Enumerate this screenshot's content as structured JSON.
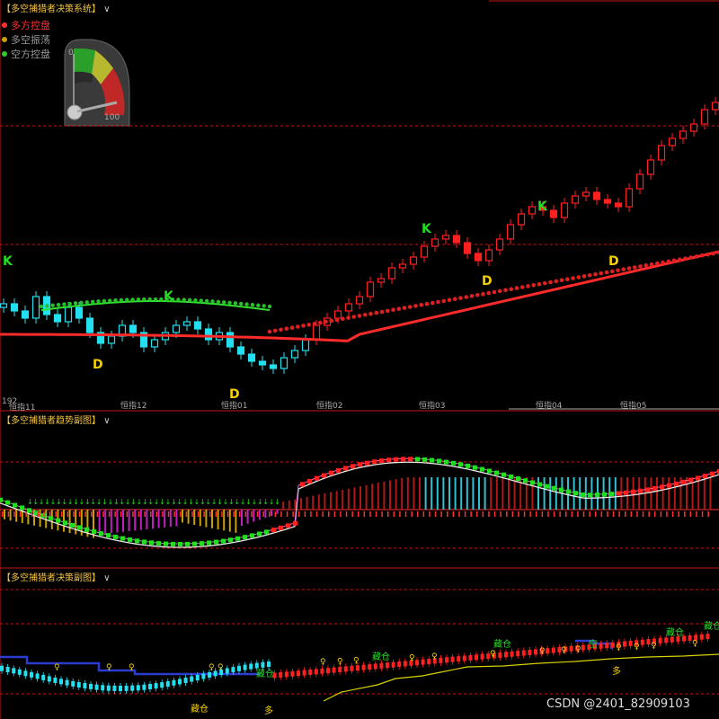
{
  "panels": {
    "main_title": "【多空捕猎者决策系统】",
    "trend_title": "【多空捕猎者趋势副图】",
    "decision_title": "【多空捕猎者决策副图】",
    "dropdown_glyph": "∨"
  },
  "legend": [
    {
      "label": "多方控盘",
      "color": "#ff3030"
    },
    {
      "label": "多空振荡",
      "color": "#c8a000"
    },
    {
      "label": "空方控盘",
      "color": "#2ecc2e"
    }
  ],
  "gauge": {
    "min_label": "0",
    "max_label": "100",
    "value": 0.85
  },
  "x_axis": {
    "first_label": "192",
    "ticks": [
      "恒指11",
      "恒指12",
      "恒指01",
      "恒指02",
      "恒指03",
      "恒指04",
      "恒指05"
    ]
  },
  "signals": {
    "k": "K",
    "d": "D"
  },
  "decision_labels": {
    "cang": "藏仓",
    "duo": "多",
    "kong": "空"
  },
  "watermark": "CSDN @2401_82909103",
  "colors": {
    "up": "#ff2020",
    "down": "#22e0f0",
    "grid": "#c01818",
    "signal_k": "#22dd22",
    "signal_d": "#f5d000"
  },
  "chart_data": {
    "type": "candlestick",
    "series": [
      {
        "values": [
          20,
          18,
          16,
          22,
          17,
          15,
          19,
          16,
          12,
          9,
          11,
          14,
          12,
          8,
          10,
          12,
          14,
          15,
          13,
          10,
          12,
          8,
          6,
          4,
          3,
          2,
          5,
          7,
          10,
          14,
          16,
          18,
          20,
          22,
          26,
          27,
          30,
          31,
          33,
          36,
          38,
          39,
          37,
          34,
          32,
          35,
          38,
          42,
          45,
          47,
          46,
          44,
          48,
          50,
          51,
          49,
          48,
          47,
          52,
          56,
          60,
          64,
          66,
          68,
          70,
          74,
          76
        ]
      }
    ]
  }
}
